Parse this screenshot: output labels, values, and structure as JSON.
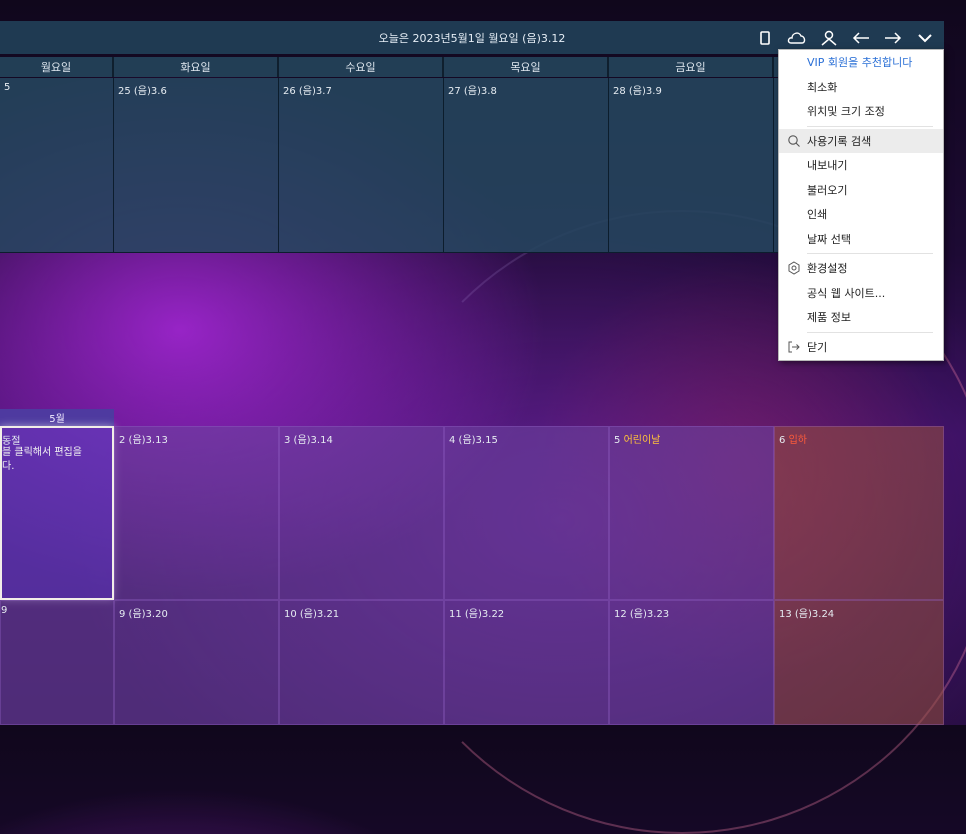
{
  "titlebar": {
    "title": "오늘은 2023년5월1일 월요일 (음)3.12",
    "icons": [
      "phone-icon",
      "cloud-icon",
      "user-icon",
      "arrow-left-icon",
      "arrow-right-icon",
      "chevron-down-icon"
    ]
  },
  "week": {
    "days": [
      "월요일",
      "화요일",
      "수요일",
      "목요일",
      "금요일",
      ""
    ]
  },
  "row1": {
    "cells": [
      "5",
      "25 (음)3.6",
      "26 (음)3.7",
      "27 (음)3.8",
      "28 (음)3.9",
      ""
    ]
  },
  "month_tab": "5월",
  "row2": {
    "c0_holiday": "동절",
    "c0_note": "블 클릭해서 편집을\n다.",
    "c1": "2 (음)3.13",
    "c2": "3 (음)3.14",
    "c3": "4 (음)3.15",
    "c4_num": "5",
    "c4_holiday": "어린이날",
    "c5_num": "6",
    "c5_holiday": "입하"
  },
  "row3": {
    "cells": [
      "9",
      "9 (음)3.20",
      "10 (음)3.21",
      "11 (음)3.22",
      "12 (음)3.23",
      "13 (음)3.24"
    ]
  },
  "menu": {
    "vip": "VIP 회원을 추천합니다",
    "minimize": "최소화",
    "position_size": "위치및 크기 조정",
    "search_history": "사용기록 검색",
    "export": "내보내기",
    "import": "불러오기",
    "print": "인쇄",
    "select_date": "날짜 선택",
    "settings": "환경설정",
    "website": "공식 웹 사이트...",
    "product_info": "제품 정보",
    "close": "닫기"
  },
  "colors": {
    "titlebar": "#1f3a52",
    "holiday": "#ffc23a",
    "vip_link": "#2a6fd6"
  }
}
